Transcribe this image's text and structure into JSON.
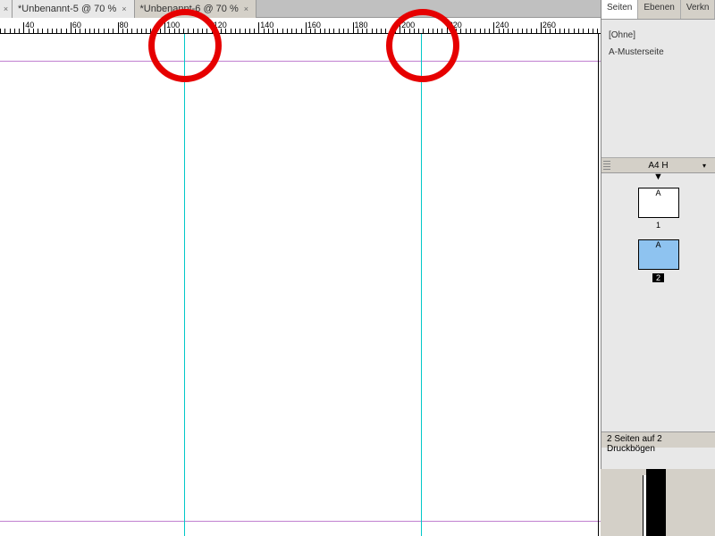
{
  "tabs": [
    {
      "label": "*Unbenannt-5 @ 70 %"
    },
    {
      "label": "*Unbenannt-6 @ 70 %"
    }
  ],
  "ruler": {
    "labels": [
      "40",
      "60",
      "80",
      "100",
      "120",
      "140",
      "160",
      "180",
      "200",
      "220",
      "240",
      "260"
    ]
  },
  "panels": {
    "tabs": [
      "Seiten",
      "Ebenen",
      "Verkn"
    ],
    "none_label": "[Ohne]",
    "master_label": "A-Musterseite",
    "format_label": "A4 H",
    "thumb_letter": "A",
    "page1_num": "1",
    "page2_num": "2",
    "footer": "2 Seiten auf 2 Druckbögen"
  }
}
